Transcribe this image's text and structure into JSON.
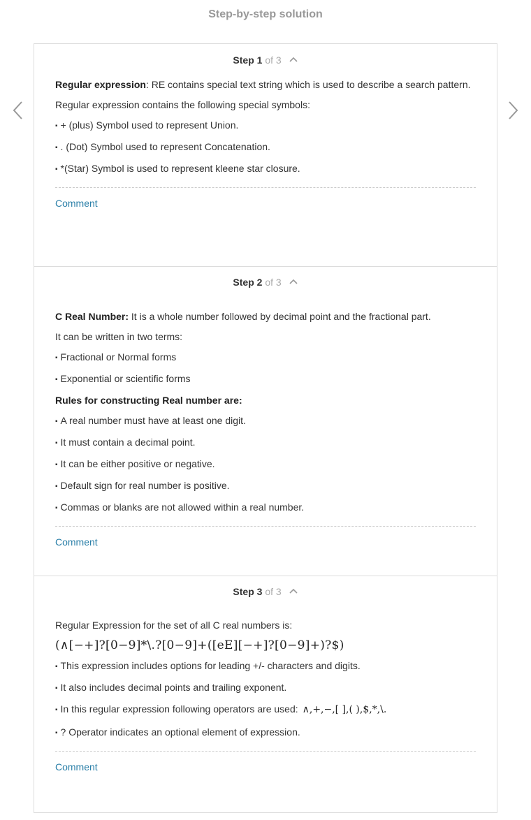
{
  "page_title": "Step-by-step solution",
  "icons": {
    "prev": "chevron-left-icon",
    "next": "chevron-right-icon",
    "collapse": "chevron-up-icon"
  },
  "colors": {
    "link": "#2a7fa8",
    "border": "#dcdcdc",
    "muted": "#999999"
  },
  "steps": [
    {
      "label": "Step 1",
      "of": "of 3",
      "comment": "Comment",
      "lines": {
        "l0_bold": "Regular expression",
        "l0_text": ": RE contains special text string which is used to describe a search pattern.",
        "l1": "Regular expression contains the following special symbols:",
        "l2": "+ (plus) Symbol used to represent Union.",
        "l3": ". (Dot) Symbol used to represent Concatenation.",
        "l4": "*(Star) Symbol is used to represent kleene star closure."
      }
    },
    {
      "label": "Step 2",
      "of": "of 3",
      "comment": "Comment",
      "lines": {
        "l0_bold": "C Real Number:",
        "l0_text": " It is a whole number followed by decimal point and the fractional part.",
        "l1": "It can be written in two terms:",
        "l2": "Fractional or Normal forms",
        "l3": "Exponential or scientific forms",
        "l4_bold": "Rules for constructing Real number are:",
        "l5": "A real number must have at least one digit.",
        "l6": "It must contain a decimal point.",
        "l7": "It can be either positive or negative.",
        "l8": "Default sign for real number is positive.",
        "l9": "Commas or blanks are not allowed within a real number."
      }
    },
    {
      "label": "Step 3",
      "of": "of 3",
      "comment": "Comment",
      "lines": {
        "l0": "Regular Expression for the set of all C real numbers is:",
        "l1_math": "(∧[−+]?[0−9]*\\.?[0−9]+([eE][−+]?[0−9]+)?$)",
        "l2": "This expression includes options for leading +/- characters and digits.",
        "l3": "It also includes decimal points and trailing exponent.",
        "l4": "In this regular expression following operators are used:",
        "l4_math": "∧,+,−,[ ],( ),$,*,\\.",
        "l5": "? Operator indicates an optional element of expression."
      }
    }
  ]
}
